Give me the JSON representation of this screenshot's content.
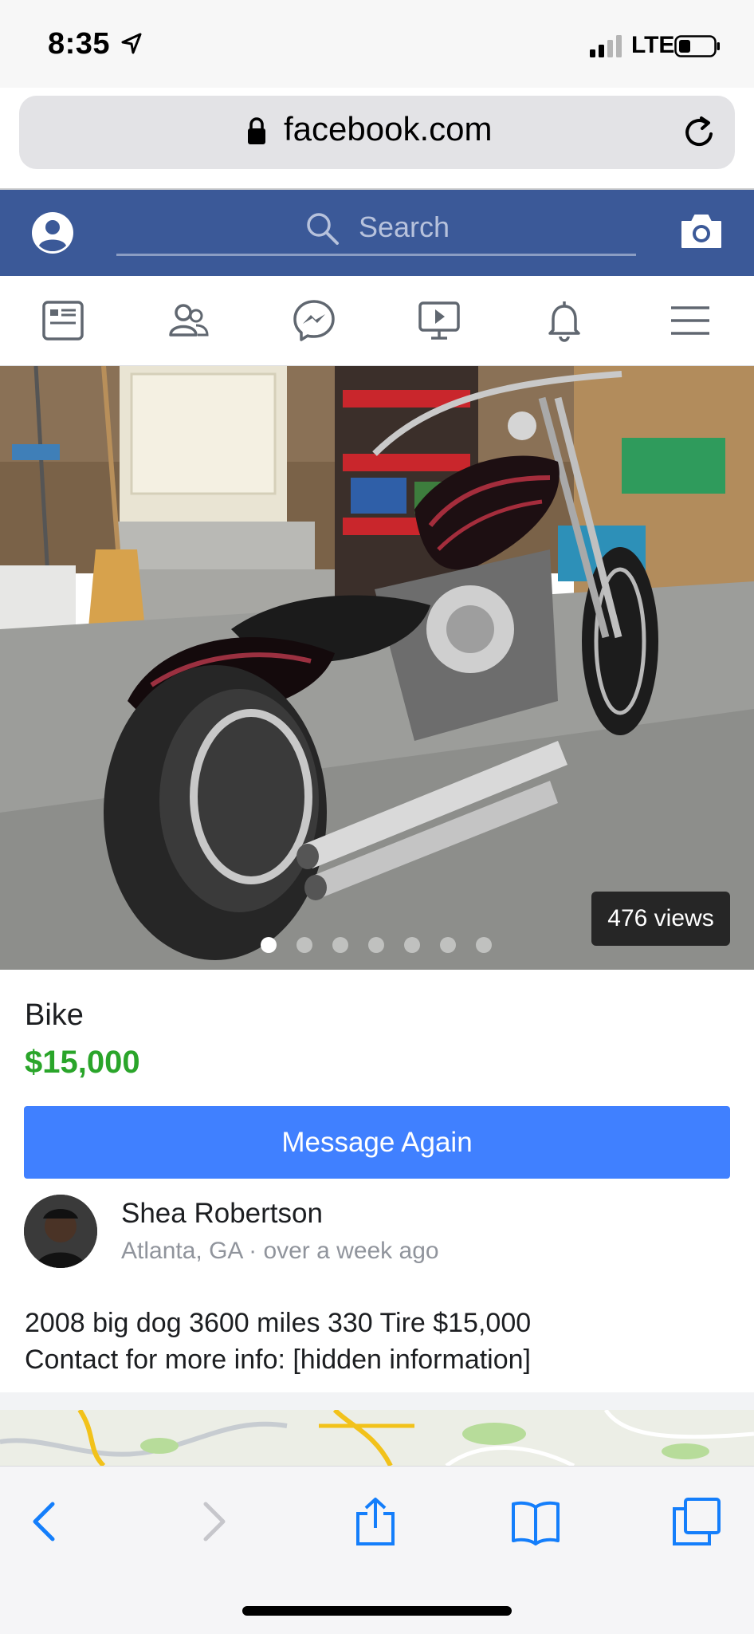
{
  "status_bar": {
    "time": "8:35",
    "network": "LTE"
  },
  "browser": {
    "url": "facebook.com"
  },
  "fb_header": {
    "search_placeholder": "Search"
  },
  "listing": {
    "views": "476 views",
    "photo_count": 7,
    "active_photo": 1,
    "title": "Bike",
    "price": "$15,000",
    "message_button": "Message Again",
    "seller": {
      "name": "Shea Robertson",
      "location": "Atlanta, GA",
      "separator": " · ",
      "posted": "over a week ago"
    },
    "description_line1": "2008 big dog 3600 miles 330 Tire $15,000",
    "description_line2": "Contact for more info: [hidden information]"
  },
  "colors": {
    "fb_blue": "#3b5998",
    "button_blue": "#4080ff",
    "price_green": "#2aa52a",
    "ios_blue": "#147efb"
  },
  "icons": {
    "nav": [
      "news-feed-icon",
      "friends-icon",
      "messenger-icon",
      "watch-icon",
      "notifications-icon",
      "menu-icon"
    ],
    "toolbar": [
      "back-icon",
      "forward-icon",
      "share-icon",
      "bookmarks-icon",
      "tabs-icon"
    ]
  }
}
